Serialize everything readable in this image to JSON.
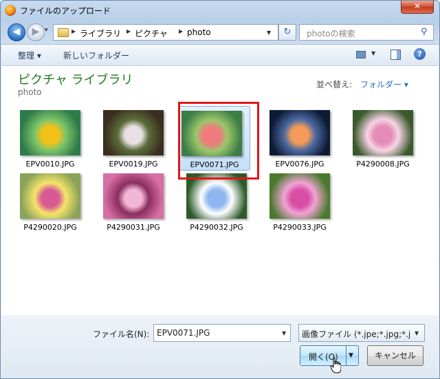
{
  "window": {
    "title": "ファイルのアップロード",
    "close_label": "✕"
  },
  "nav": {
    "back_glyph": "◀",
    "forward_glyph": "▶",
    "breadcrumb": [
      "ライブラリ",
      "ピクチャ",
      "photo"
    ],
    "refresh_glyph": "↻",
    "search_placeholder": "photoの検索",
    "search_icon": "search-icon"
  },
  "toolbar": {
    "organize_label": "整理 ▾",
    "new_folder_label": "新しいフォルダー",
    "help_glyph": "?"
  },
  "library": {
    "title": "ピクチャ ライブラリ",
    "subtitle": "photo",
    "sort_label": "並べ替え:",
    "sort_value": "フォルダー ▾"
  },
  "files": [
    {
      "name": "EPV0010.JPG",
      "colors": [
        "#2f7b4a",
        "#f2c21b",
        "#7cc46a"
      ],
      "selected": false
    },
    {
      "name": "EPV0019.JPG",
      "colors": [
        "#3b2d1f",
        "#e8e0e2",
        "#5b6d3a"
      ],
      "selected": false
    },
    {
      "name": "EPV0071.JPG",
      "colors": [
        "#3d7d46",
        "#f07b7e",
        "#9cc66a"
      ],
      "selected": true
    },
    {
      "name": "EPV0076.JPG",
      "colors": [
        "#0e1a34",
        "#f29b5a",
        "#4b6aa1"
      ],
      "selected": false
    },
    {
      "name": "P4290008.JPG",
      "colors": [
        "#3a5a2c",
        "#e48bb8",
        "#f6d4e6"
      ],
      "selected": false
    },
    {
      "name": "P4290020.JPG",
      "colors": [
        "#8aa35a",
        "#d85a95",
        "#f6e46a"
      ],
      "selected": false
    },
    {
      "name": "P4290031.JPG",
      "colors": [
        "#d86fa4",
        "#f3b7d6",
        "#8a2d5e"
      ],
      "selected": false
    },
    {
      "name": "P4290032.JPG",
      "colors": [
        "#2c5b2a",
        "#8fb6ee",
        "#ffffff"
      ],
      "selected": false
    },
    {
      "name": "P4290033.JPG",
      "colors": [
        "#4b7a2f",
        "#d64fa5",
        "#f2a4d4"
      ],
      "selected": false
    }
  ],
  "bottom": {
    "filename_label": "ファイル名(N):",
    "filename_value": "EPV0071.JPG",
    "filetype_value": "画像ファイル (*.jpe;*.jpg;*.j",
    "open_label": "開く(O)",
    "cancel_label": "キャンセル"
  },
  "colors": {
    "accent_green": "#1e7b1e",
    "link_blue": "#2a6dc0",
    "highlight_red": "#e11616"
  }
}
